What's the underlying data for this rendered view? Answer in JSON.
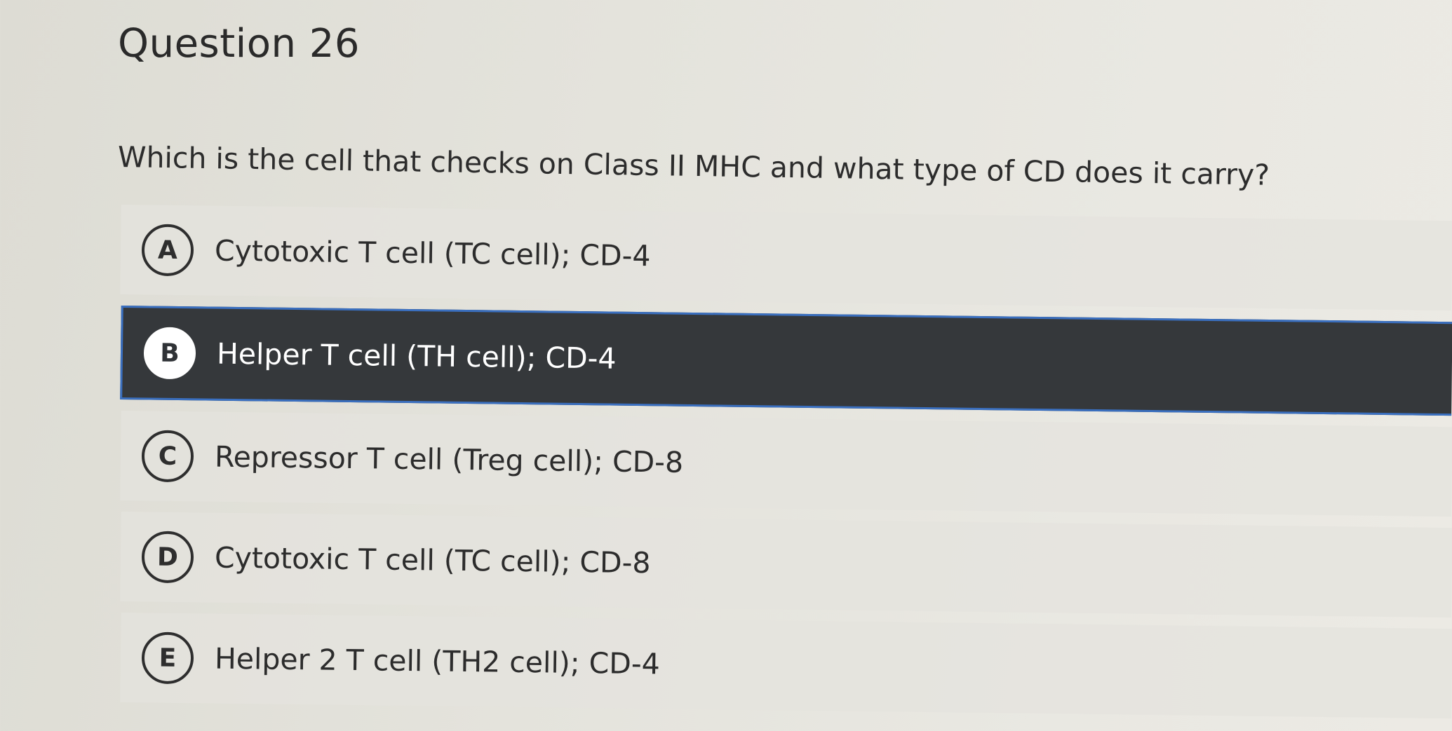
{
  "question": {
    "title": "Question 26",
    "text": "Which is the cell that checks on Class II MHC and what type of CD does it carry?"
  },
  "options": [
    {
      "letter": "A",
      "label": "Cytotoxic T cell (TC cell); CD-4",
      "selected": false
    },
    {
      "letter": "B",
      "label": "Helper T cell (TH cell); CD-4",
      "selected": true
    },
    {
      "letter": "C",
      "label": "Repressor T cell (Treg cell); CD-8",
      "selected": false
    },
    {
      "letter": "D",
      "label": "Cytotoxic T cell (TC cell); CD-8",
      "selected": false
    },
    {
      "letter": "E",
      "label": "Helper 2 T cell (TH2 cell); CD-4",
      "selected": false
    }
  ],
  "colors": {
    "selected_background": "#35383b",
    "selected_border": "#3a6fbf",
    "page_background": "#e4e3dc"
  }
}
